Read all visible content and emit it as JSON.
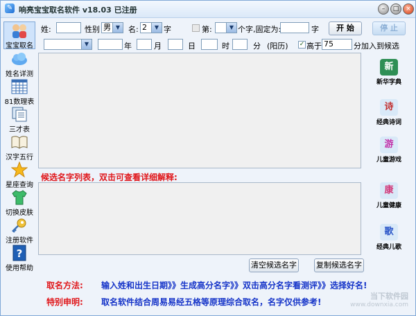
{
  "window": {
    "title": "响亮宝宝取名软件 v18.03  已注册"
  },
  "sidebar": [
    {
      "label": "宝宝取名",
      "icon": "baby-icon"
    },
    {
      "label": "姓名详测",
      "icon": "cloud-icon"
    },
    {
      "label": "81数理表",
      "icon": "table-icon"
    },
    {
      "label": "三才表",
      "icon": "docs-icon"
    },
    {
      "label": "汉字五行",
      "icon": "book-icon"
    },
    {
      "label": "星座查询",
      "icon": "star-icon"
    },
    {
      "label": "切换皮肤",
      "icon": "shirt-icon"
    },
    {
      "label": "注册软件",
      "icon": "key-icon"
    },
    {
      "label": "使用帮助",
      "icon": "help-icon"
    }
  ],
  "form": {
    "surname_label": "姓:",
    "surname_value": "",
    "gender_label": "性别",
    "gender_value": "男",
    "name_label": "名:",
    "name_len_value": "2",
    "name_len_suffix": "字",
    "pos_label": "第:",
    "pos_value": "",
    "fixed_label": "个字,固定为:",
    "fixed_value": "",
    "fixed_suffix": "字",
    "start_button": "开 始",
    "stop_button": "停 止",
    "year_label": "年",
    "month_label": "月",
    "day_label": "日",
    "hour_label": "时",
    "minute_label": "分",
    "solar_label": "(阳历)",
    "higher_label": "高于",
    "higher_value": "75",
    "higher_suffix": "分加入到候选"
  },
  "candidate_title": "候选名字列表，双击可查看详细解释:",
  "buttons": {
    "clear": "清空候选名字",
    "copy": "复制候选名字"
  },
  "right_tools": [
    {
      "label": "新华字典",
      "glyph": "新"
    },
    {
      "label": "经典诗词",
      "glyph": "诗"
    },
    {
      "label": "儿童游戏",
      "glyph": "游"
    },
    {
      "label": "儿童健康",
      "glyph": "康"
    },
    {
      "label": "经典儿歌",
      "glyph": "歌"
    }
  ],
  "footer": {
    "method_label": "取名方法:",
    "method_text": "输入姓和出生日期》》生成高分名字》》双击高分名字看测评》》选择好名!",
    "notice_label": "特别申明:",
    "notice_text": "取名软件结合周易易经五格等原理综合取名，名字仅供参考!"
  },
  "watermark": {
    "line1": "当下软件园",
    "line2": "www.downxia.com"
  }
}
